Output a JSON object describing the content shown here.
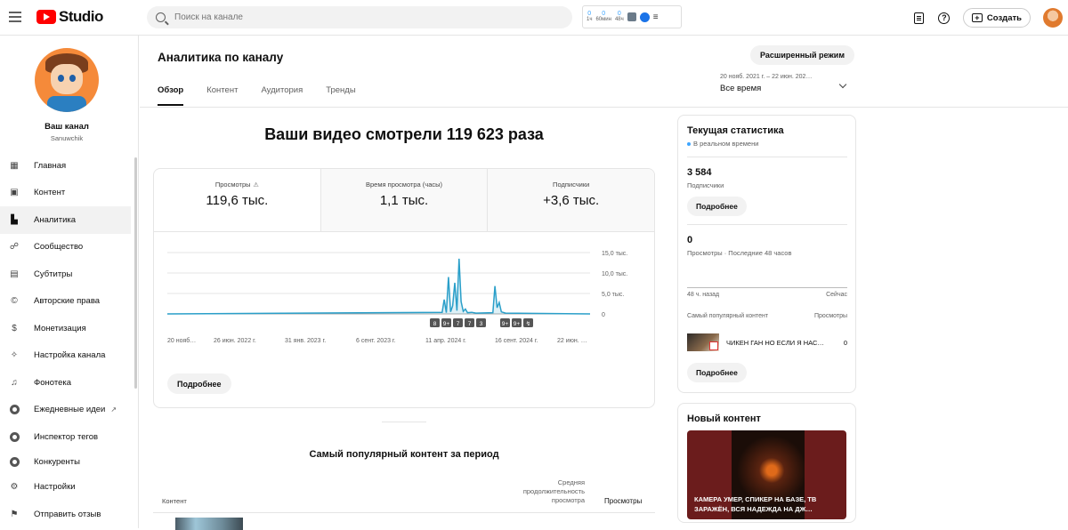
{
  "topbar": {
    "logo_text": "Studio",
    "search_placeholder": "Поиск на канале",
    "ext_stats": [
      {
        "value": "0",
        "label": "1ч"
      },
      {
        "value": "0",
        "label": "60мин"
      },
      {
        "value": "0",
        "label": "48ч"
      }
    ],
    "create_label": "Создать"
  },
  "sidebar": {
    "channel_name": "Ваш канал",
    "channel_handle": "Sanuwchik",
    "items": [
      {
        "label": "Главная",
        "icon": "dashboard-icon"
      },
      {
        "label": "Контент",
        "icon": "content-icon"
      },
      {
        "label": "Аналитика",
        "icon": "analytics-icon",
        "active": true
      },
      {
        "label": "Сообщество",
        "icon": "community-icon"
      },
      {
        "label": "Субтитры",
        "icon": "subtitles-icon"
      },
      {
        "label": "Авторские права",
        "icon": "copyright-icon"
      },
      {
        "label": "Монетизация",
        "icon": "monetization-icon"
      },
      {
        "label": "Настройка канала",
        "icon": "customization-icon"
      },
      {
        "label": "Фонотека",
        "icon": "audio-library-icon"
      },
      {
        "label": "Ежедневные идеи",
        "icon": "daily-ideas-icon"
      },
      {
        "label": "Инспектор тегов",
        "icon": "tag-inspector-icon"
      },
      {
        "label": "Конкуренты",
        "icon": "competitors-icon"
      },
      {
        "label": "Настройки",
        "icon": "settings-icon"
      },
      {
        "label": "Отправить отзыв",
        "icon": "feedback-icon"
      }
    ]
  },
  "main": {
    "title": "Аналитика по каналу",
    "advanced_button": "Расширенный режим",
    "tabs": [
      {
        "label": "Обзор",
        "active": true
      },
      {
        "label": "Контент"
      },
      {
        "label": "Аудитория"
      },
      {
        "label": "Тренды"
      }
    ],
    "date_range_text": "20 нояб. 2021 г. – 22 июн. 202…",
    "date_range_label": "Все время",
    "headline": "Ваши видео смотрели 119 623 раза",
    "metrics": [
      {
        "label": "Просмотры",
        "value": "119,6 тыс."
      },
      {
        "label": "Время просмотра (часы)",
        "value": "1,1 тыс."
      },
      {
        "label": "Подписчики",
        "value": "+3,6 тыс."
      }
    ],
    "more_button": "Подробнее",
    "top_content_title": "Самый популярный контент за период",
    "table_headers": {
      "content": "Контент",
      "avg_duration": "Средняя продолжительность просмотра",
      "views": "Просмотры"
    }
  },
  "chart_data": {
    "type": "line",
    "ylabel": "",
    "y_ticks": [
      "15,0 тыс.",
      "10,0 тыс.",
      "5,0 тыс.",
      "0"
    ],
    "ylim": [
      0,
      15000
    ],
    "x_tick_labels": [
      "20 нояб…",
      "26 июн. 2022 г.",
      "31 янв. 2023 г.",
      "6 сент. 2023 г.",
      "11 апр. 2024 г.",
      "16 сент. 2024 г.",
      "22 июн. …"
    ],
    "series": [
      {
        "color": "#2a9fc9",
        "x": [
          0,
          0.65,
          0.655,
          0.66,
          0.665,
          0.67,
          0.675,
          0.68,
          0.685,
          0.69,
          0.695,
          0.7,
          0.705,
          0.71,
          0.72,
          0.73,
          0.77,
          0.775,
          0.78,
          0.785,
          0.79,
          0.8,
          1.0
        ],
        "values": [
          0,
          400,
          3500,
          300,
          9000,
          500,
          2000,
          7600,
          800,
          13500,
          3000,
          600,
          1200,
          300,
          400,
          200,
          300,
          6800,
          1500,
          2800,
          500,
          200,
          0
        ]
      }
    ],
    "markers": [
      "8",
      "9+",
      "7",
      "7",
      "3",
      "9+",
      "9+",
      "↯"
    ],
    "grid": true
  },
  "realtime": {
    "title": "Текущая статистика",
    "live_label": "В реальном времени",
    "subs_value": "3 584",
    "subs_label": "Подписчики",
    "more_1": "Подробнее",
    "views_value": "0",
    "views_label": "Просмотры · Последние 48 часов",
    "axis_left": "48 ч. назад",
    "axis_right": "Сейчас",
    "popular_header": "Самый популярный контент",
    "popular_views_header": "Просмотры",
    "popular_item_title": "ЧИКЕН ГАН НО ЕСЛИ Я НАС…",
    "popular_item_views": "0",
    "more_2": "Подробнее"
  },
  "new_content": {
    "title": "Новый контент",
    "video_caption": "КАМЕРА УМЕР, СПИКЕР НА БАЗЕ, ТВ ЗАРАЖЁН, ВСЯ НАДЕЖДА НА ДЖ…"
  }
}
